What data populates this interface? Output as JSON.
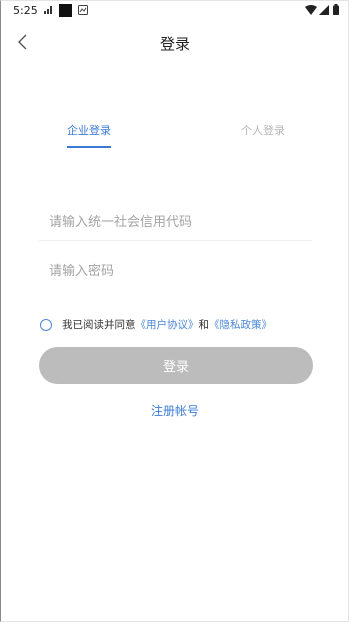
{
  "status_bar": {
    "time": "5:25",
    "icons": [
      "signal-small-icon",
      "black-square-icon",
      "notification-icon",
      "wifi-icon",
      "cellular-icon",
      "battery-icon"
    ]
  },
  "header": {
    "back_icon": "chevron-left-icon",
    "title": "登录"
  },
  "tabs": [
    {
      "label": "企业登录",
      "active": true
    },
    {
      "label": "个人登录",
      "active": false
    }
  ],
  "form": {
    "credit_code_placeholder": "请输入统一社会信用代码",
    "password_placeholder": "请输入密码"
  },
  "agreement": {
    "prefix": "我已阅读并同意",
    "user_agreement": "《用户协议》",
    "conjunction": "和",
    "privacy_policy": "《隐私政策》"
  },
  "login_button": "登录",
  "register_link": "注册帐号",
  "colors": {
    "accent": "#3b7bd5",
    "button_disabled": "#bcbcbc",
    "inactive_tab": "#b7b7b7"
  }
}
